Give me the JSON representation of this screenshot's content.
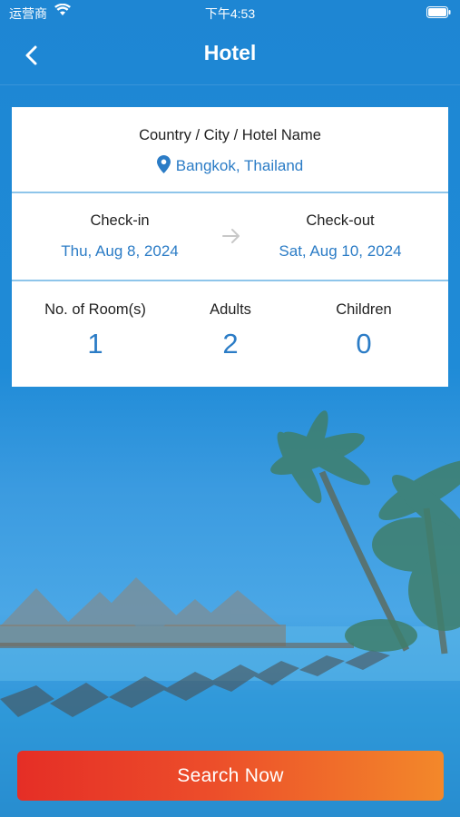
{
  "status_bar": {
    "carrier": "运营商",
    "time": "下午4:53"
  },
  "nav": {
    "title": "Hotel"
  },
  "destination": {
    "label": "Country / City / Hotel Name",
    "value": "Bangkok, Thailand"
  },
  "dates": {
    "check_in_label": "Check-in",
    "check_in_value": "Thu, Aug 8, 2024",
    "check_out_label": "Check-out",
    "check_out_value": "Sat, Aug 10, 2024"
  },
  "guests": {
    "rooms_label": "No. of Room(s)",
    "rooms_value": "1",
    "adults_label": "Adults",
    "adults_value": "2",
    "children_label": "Children",
    "children_value": "0"
  },
  "search": {
    "label": "Search Now"
  },
  "colors": {
    "accent": "#2b7cc6",
    "header_blue": "#1e86d3",
    "button_start": "#e52e26",
    "button_end": "#f3882a"
  },
  "icons": {
    "back": "chevron-left-icon",
    "pin": "location-pin-icon",
    "arrow": "arrow-right-icon",
    "wifi": "wifi-icon",
    "battery": "battery-icon"
  }
}
